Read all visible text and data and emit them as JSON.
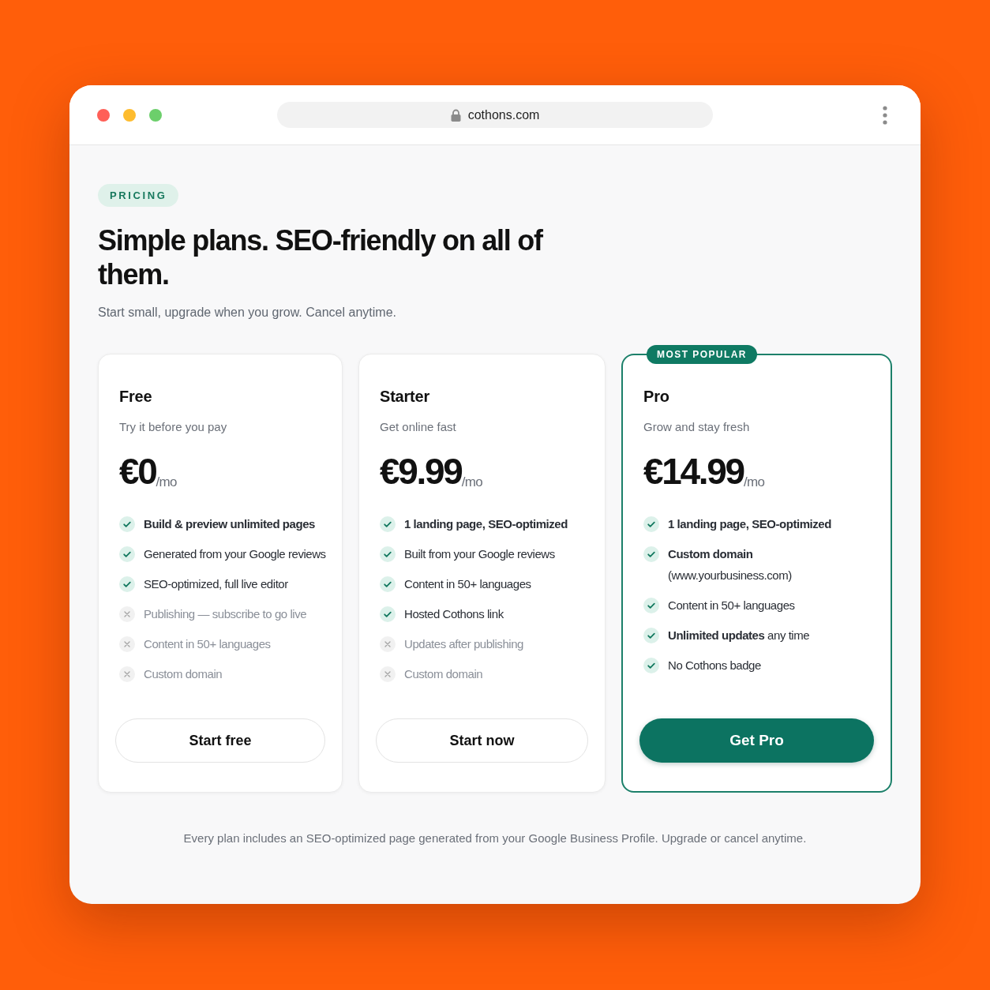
{
  "browser": {
    "url": "cothons.com"
  },
  "header": {
    "eyebrow": "PRICING",
    "title": "Simple plans. SEO-friendly on all of them.",
    "subtitle": "Start small, upgrade when you grow. Cancel anytime."
  },
  "plans": [
    {
      "name": "Free",
      "tagline": "Try it before you pay",
      "price": "€0",
      "period": "/mo",
      "featured": false,
      "features": [
        {
          "text": "Build & preview unlimited pages",
          "included": true,
          "bold": true
        },
        {
          "text": "Generated from your Google reviews",
          "included": true,
          "bold": false
        },
        {
          "text": "SEO-optimized, full live editor",
          "included": true,
          "bold": false
        },
        {
          "text": "Publishing — subscribe to go live",
          "included": false,
          "bold": false
        },
        {
          "text": "Content in 50+ languages",
          "included": false,
          "bold": false
        },
        {
          "text": "Custom domain",
          "included": false,
          "bold": false
        }
      ],
      "button": "Start free"
    },
    {
      "name": "Starter",
      "tagline": "Get online fast",
      "price": "€9.99",
      "period": "/mo",
      "featured": false,
      "features": [
        {
          "text": "1 landing page, SEO-optimized",
          "included": true,
          "bold": true
        },
        {
          "text": "Built from your Google reviews",
          "included": true,
          "bold": false
        },
        {
          "text": "Content in 50+ languages",
          "included": true,
          "bold": false
        },
        {
          "text": "Hosted Cothons link",
          "included": true,
          "bold": false
        },
        {
          "text": "Updates after publishing",
          "included": false,
          "bold": false
        },
        {
          "text": "Custom domain",
          "included": false,
          "bold": false
        }
      ],
      "button": "Start now"
    },
    {
      "name": "Pro",
      "badge": "MOST POPULAR",
      "tagline": "Grow and stay fresh",
      "price": "€14.99",
      "period": "/mo",
      "featured": true,
      "features": [
        {
          "text": "1 landing page, SEO-optimized",
          "included": true,
          "bold": true
        },
        {
          "text": "**Custom domain** (www.yourbusiness.com)",
          "included": true,
          "bold": false
        },
        {
          "text": "Content in 50+ languages",
          "included": true,
          "bold": false
        },
        {
          "text": "**Unlimited updates** any time",
          "included": true,
          "bold": false
        },
        {
          "text": "No Cothons badge",
          "included": true,
          "bold": false
        }
      ],
      "button": "Get Pro"
    }
  ],
  "footnote": "Every plan includes an SEO-optimized page generated from your Google Business Profile. Upgrade or cancel anytime."
}
